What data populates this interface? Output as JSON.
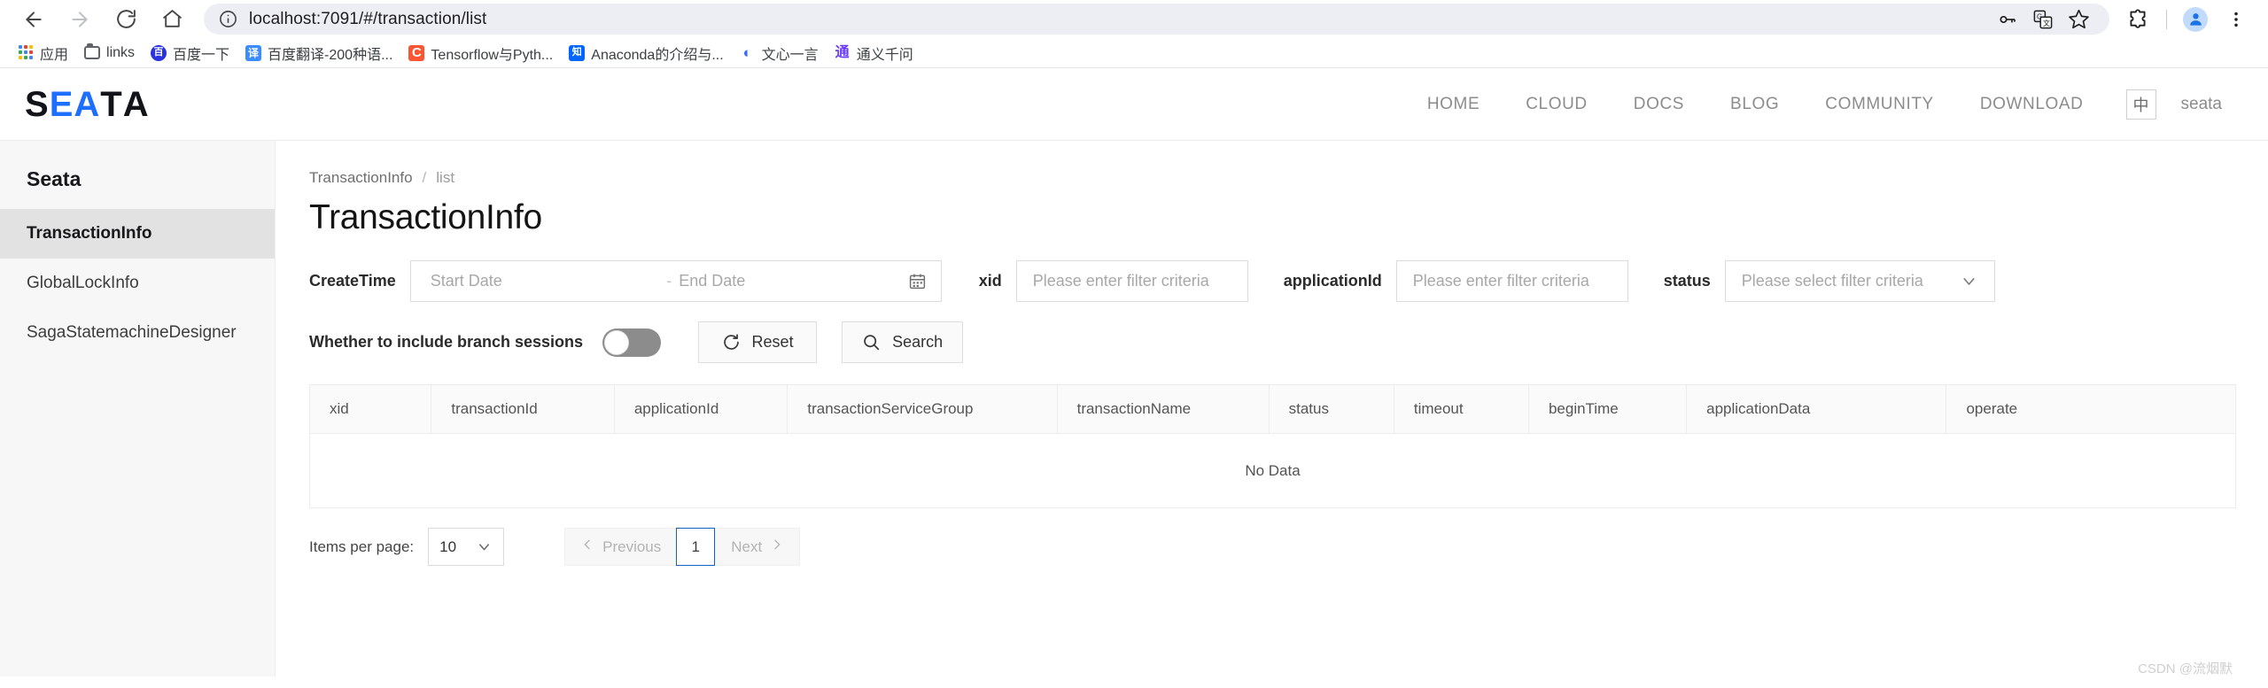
{
  "browser": {
    "url": "localhost:7091/#/transaction/list",
    "nav": {
      "back": "back-arrow",
      "forward": "forward-arrow",
      "reload": "reload",
      "home": "home"
    },
    "omni_icons": [
      "password-key-icon",
      "translate-icon",
      "bookmark-star-icon"
    ],
    "right_icons": [
      "extensions-icon",
      "profile-avatar",
      "more-menu-icon"
    ],
    "bookmarks": [
      {
        "label": "应用",
        "icon": "apps-grid-icon"
      },
      {
        "label": "links",
        "icon": "folder-icon"
      },
      {
        "label": "百度一下",
        "icon": "baidu-icon",
        "glyph": "百"
      },
      {
        "label": "百度翻译-200种语...",
        "icon": "baidu-fanyi-icon",
        "glyph": "译"
      },
      {
        "label": "Tensorflow与Pyth...",
        "icon": "csdn-icon",
        "glyph": "C"
      },
      {
        "label": "Anaconda的介绍与...",
        "icon": "zhihu-icon",
        "glyph": "知"
      },
      {
        "label": "文心一言",
        "icon": "wenxin-icon",
        "glyph": "◐"
      },
      {
        "label": "通义千问",
        "icon": "tongyi-icon",
        "glyph": "通"
      }
    ]
  },
  "site_header": {
    "logo": [
      {
        "t": "S",
        "c": "k"
      },
      {
        "t": "E",
        "c": "b"
      },
      {
        "t": "A",
        "c": "b"
      },
      {
        "t": "T",
        "c": "k"
      },
      {
        "t": "A",
        "c": "k"
      }
    ],
    "logo_text": "SEATA",
    "nav": [
      "HOME",
      "CLOUD",
      "DOCS",
      "BLOG",
      "COMMUNITY",
      "DOWNLOAD"
    ],
    "lang_toggle": "中",
    "user": "seata",
    "accent_color": "#1f6fff"
  },
  "sidebar": {
    "brand": "Seata",
    "items": [
      {
        "label": "TransactionInfo",
        "active": true
      },
      {
        "label": "GlobalLockInfo",
        "active": false
      },
      {
        "label": "SagaStatemachineDesigner",
        "active": false
      }
    ]
  },
  "main": {
    "breadcrumb": {
      "root": "TransactionInfo",
      "sep": "/",
      "current": "list"
    },
    "title": "TransactionInfo",
    "filters": {
      "createtime_label": "CreateTime",
      "start_date_placeholder": "Start Date",
      "range_dash": "-",
      "end_date_placeholder": "End Date",
      "calendar_icon": "calendar-icon",
      "xid_label": "xid",
      "xid_placeholder": "Please enter filter criteria",
      "applicationid_label": "applicationId",
      "applicationid_placeholder": "Please enter filter criteria",
      "status_label": "status",
      "status_placeholder": "Please select filter criteria"
    },
    "actions": {
      "switch_label": "Whether to include branch sessions",
      "switch_on": false,
      "reset_label": "Reset",
      "search_label": "Search"
    },
    "table": {
      "columns": [
        "xid",
        "transactionId",
        "applicationId",
        "transactionServiceGroup",
        "transactionName",
        "status",
        "timeout",
        "beginTime",
        "applicationData",
        "operate"
      ],
      "rows": [],
      "empty_text": "No Data"
    },
    "pagination": {
      "items_per_page_label": "Items per page:",
      "page_size": "10",
      "previous_label": "Previous",
      "current_page": "1",
      "next_label": "Next",
      "active_border_color": "#1565c0"
    }
  },
  "watermark": "CSDN @流烟默"
}
